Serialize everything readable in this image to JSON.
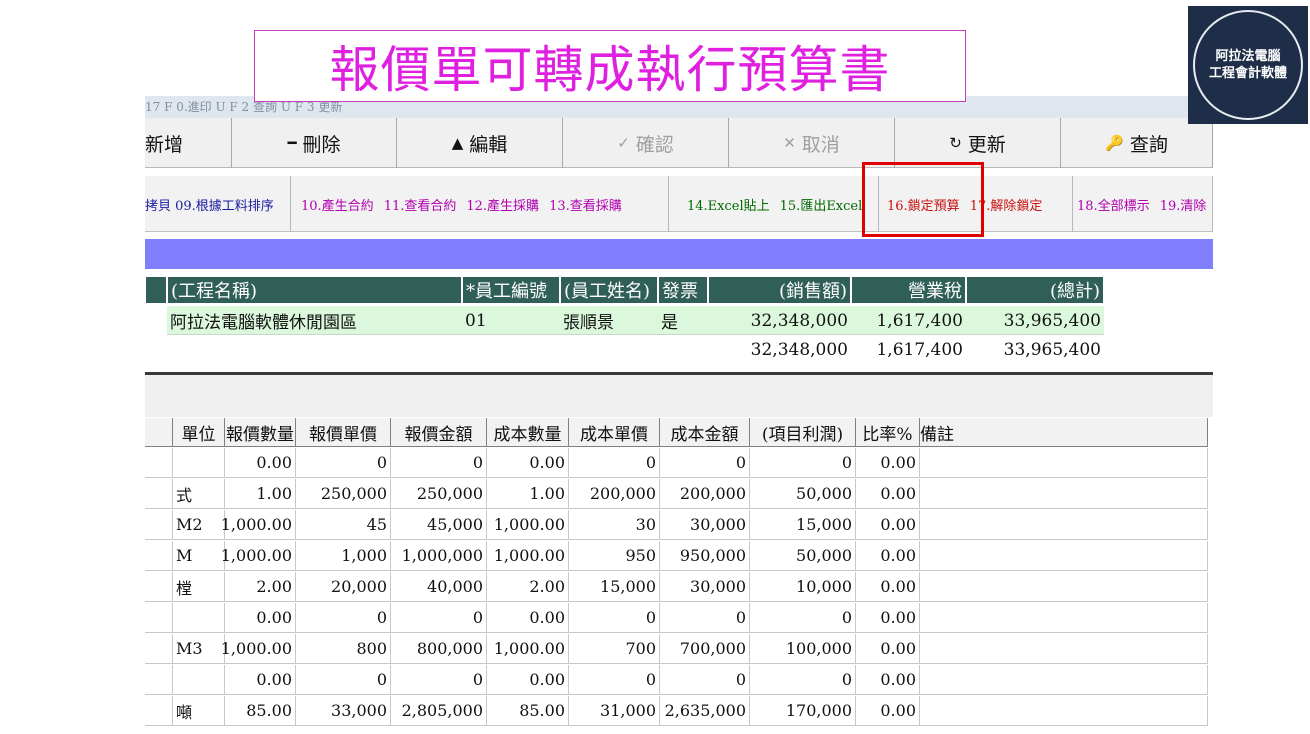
{
  "title": "報價單可轉成執行預算書",
  "logo": {
    "line1": "阿拉法電腦",
    "line2": "工程會計軟體"
  },
  "menu_strip": "17 F 0.進印 U F 2 查詢 U F 3 更新",
  "toolbar": [
    {
      "label": "新增",
      "icon": "",
      "icon_name": "add-icon",
      "disabled": false
    },
    {
      "label": "刪除",
      "icon": "━",
      "icon_name": "minus-icon",
      "disabled": false
    },
    {
      "label": "編輯",
      "icon": "▲",
      "icon_name": "triangle-up-icon",
      "disabled": false
    },
    {
      "label": "確認",
      "icon": "✓",
      "icon_name": "check-icon",
      "disabled": true
    },
    {
      "label": "取消",
      "icon": "✕",
      "icon_name": "x-icon",
      "disabled": true
    },
    {
      "label": "更新",
      "icon": "↻",
      "icon_name": "refresh-icon",
      "disabled": false
    },
    {
      "label": "查詢",
      "icon": "🔑",
      "icon_name": "key-icon",
      "disabled": false
    }
  ],
  "functions": {
    "group1": [
      {
        "label": "拷貝 09.根據工料排序"
      }
    ],
    "group2": [
      {
        "label": "10.產生合約"
      },
      {
        "label": "11.查看合約"
      },
      {
        "label": "12.產生採購"
      },
      {
        "label": "13.查看採購"
      }
    ],
    "group3": [
      {
        "label": "14.Excel貼上"
      },
      {
        "label": "15.匯出Excel"
      }
    ],
    "group4": [
      {
        "label": "16.鎖定預算"
      },
      {
        "label": "17.解除鎖定"
      }
    ],
    "group5": [
      {
        "label": "18.全部標示"
      },
      {
        "label": "19.清除"
      }
    ]
  },
  "upper_table": {
    "headers": [
      "(工程名稱)",
      "*員工編號",
      "(員工姓名)",
      "發票",
      "(銷售額)",
      "營業稅",
      "(總計)"
    ],
    "row": [
      "阿拉法電腦軟體休閒園區",
      "01",
      "張順景",
      "是",
      "32,348,000",
      "1,617,400",
      "33,965,400"
    ],
    "totals": [
      "32,348,000",
      "1,617,400",
      "33,965,400"
    ]
  },
  "lower_table": {
    "headers": [
      "單位",
      "報價數量",
      "報價單價",
      "報價金額",
      "成本數量",
      "成本單價",
      "成本金額",
      "(項目利潤)",
      "比率%",
      "備註"
    ],
    "rows": [
      [
        "",
        "0.00",
        "0",
        "0",
        "0.00",
        "0",
        "0",
        "0",
        "0.00",
        ""
      ],
      [
        "式",
        "1.00",
        "250,000",
        "250,000",
        "1.00",
        "200,000",
        "200,000",
        "50,000",
        "0.00",
        ""
      ],
      [
        "M2",
        "1,000.00",
        "45",
        "45,000",
        "1,000.00",
        "30",
        "30,000",
        "15,000",
        "0.00",
        ""
      ],
      [
        "M",
        "1,000.00",
        "1,000",
        "1,000,000",
        "1,000.00",
        "950",
        "950,000",
        "50,000",
        "0.00",
        ""
      ],
      [
        "樘",
        "2.00",
        "20,000",
        "40,000",
        "2.00",
        "15,000",
        "30,000",
        "10,000",
        "0.00",
        ""
      ],
      [
        "",
        "0.00",
        "0",
        "0",
        "0.00",
        "0",
        "0",
        "0",
        "0.00",
        ""
      ],
      [
        "M3",
        "1,000.00",
        "800",
        "800,000",
        "1,000.00",
        "700",
        "700,000",
        "100,000",
        "0.00",
        ""
      ],
      [
        "",
        "0.00",
        "0",
        "0",
        "0.00",
        "0",
        "0",
        "0",
        "0.00",
        ""
      ],
      [
        "噸",
        "85.00",
        "33,000",
        "2,805,000",
        "85.00",
        "31,000",
        "2,635,000",
        "170,000",
        "0.00",
        ""
      ]
    ]
  },
  "colors": {
    "title": "#e020e0",
    "header_green": "#2f5f57",
    "band_blue": "#8080ff",
    "highlight_red": "#e00000",
    "row_green": "#dcf8dc"
  }
}
